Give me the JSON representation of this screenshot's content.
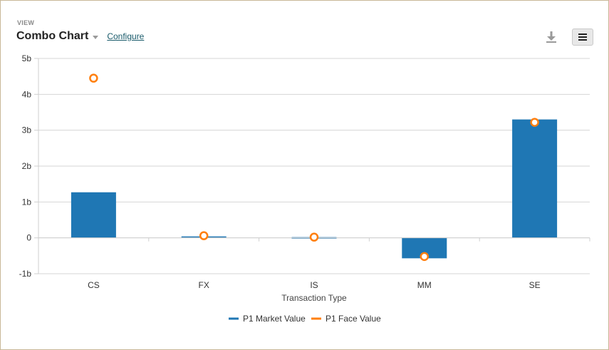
{
  "header": {
    "view_label": "VIEW",
    "title": "Combo Chart",
    "configure_label": "Configure",
    "download_icon": "download-icon",
    "menu_icon": "hamburger-menu-icon"
  },
  "chart_data": {
    "type": "bar",
    "categories": [
      "CS",
      "FX",
      "IS",
      "MM",
      "SE"
    ],
    "series": [
      {
        "name": "P1 Market Value",
        "kind": "bar",
        "color": "#1f77b4",
        "values": [
          1.27,
          0.04,
          0.02,
          -0.57,
          3.3
        ]
      },
      {
        "name": "P1 Face Value",
        "kind": "marker",
        "color": "#ff7f0e",
        "values": [
          4.45,
          0.06,
          0.02,
          -0.52,
          3.22
        ]
      }
    ],
    "xlabel": "Transaction Type",
    "ylabel": "",
    "ylim": [
      -1,
      5
    ],
    "yticks": [
      {
        "value": 5,
        "label": "5b"
      },
      {
        "value": 4,
        "label": "4b"
      },
      {
        "value": 3,
        "label": "3b"
      },
      {
        "value": 2,
        "label": "2b"
      },
      {
        "value": 1,
        "label": "1b"
      },
      {
        "value": 0,
        "label": "0"
      },
      {
        "value": -1,
        "label": "-1b"
      }
    ],
    "grid": true,
    "legend_position": "bottom"
  }
}
